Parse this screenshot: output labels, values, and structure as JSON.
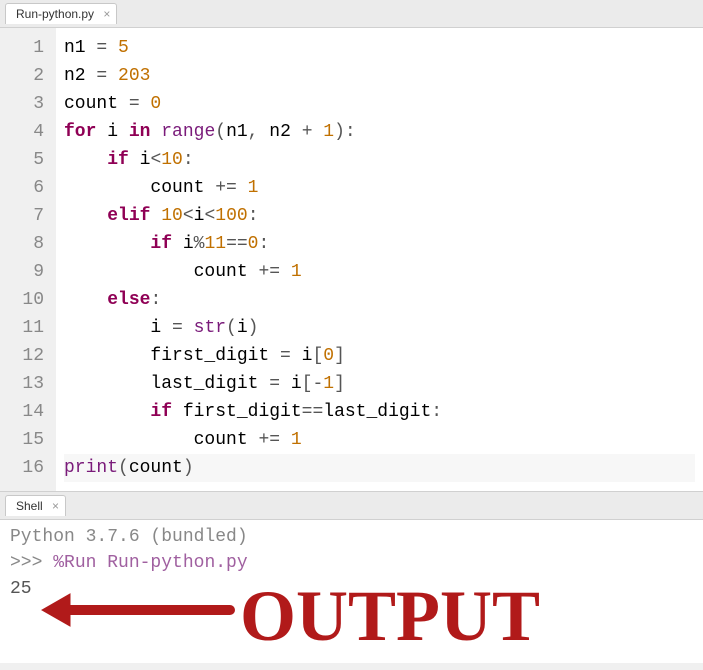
{
  "editor_tab": {
    "title": "Run-python.py"
  },
  "gutter": [
    "1",
    "2",
    "3",
    "4",
    "5",
    "6",
    "7",
    "8",
    "9",
    "10",
    "11",
    "12",
    "13",
    "14",
    "15",
    "16"
  ],
  "code": {
    "l1": [
      [
        "name",
        "n1"
      ],
      [
        "op",
        " = "
      ],
      [
        "num",
        "5"
      ]
    ],
    "l2": [
      [
        "name",
        "n2"
      ],
      [
        "op",
        " = "
      ],
      [
        "num",
        "203"
      ]
    ],
    "l3": [
      [
        "name",
        "count"
      ],
      [
        "op",
        " = "
      ],
      [
        "num",
        "0"
      ]
    ],
    "l4": [
      [
        "kw",
        "for"
      ],
      [
        "name",
        " i "
      ],
      [
        "kw",
        "in"
      ],
      [
        "name",
        " "
      ],
      [
        "builtin",
        "range"
      ],
      [
        "paren",
        "("
      ],
      [
        "name",
        "n1"
      ],
      [
        "punc",
        ", "
      ],
      [
        "name",
        "n2"
      ],
      [
        "op",
        " + "
      ],
      [
        "num",
        "1"
      ],
      [
        "paren",
        ")"
      ],
      [
        "punc",
        ":"
      ]
    ],
    "l5": [
      [
        "name",
        "    "
      ],
      [
        "kw",
        "if"
      ],
      [
        "name",
        " i"
      ],
      [
        "op",
        "<"
      ],
      [
        "num",
        "10"
      ],
      [
        "punc",
        ":"
      ]
    ],
    "l6": [
      [
        "name",
        "        count "
      ],
      [
        "op",
        "+= "
      ],
      [
        "num",
        "1"
      ]
    ],
    "l7": [
      [
        "name",
        "    "
      ],
      [
        "kw",
        "elif"
      ],
      [
        "name",
        " "
      ],
      [
        "num",
        "10"
      ],
      [
        "op",
        "<"
      ],
      [
        "name",
        "i"
      ],
      [
        "op",
        "<"
      ],
      [
        "num",
        "100"
      ],
      [
        "punc",
        ":"
      ]
    ],
    "l8": [
      [
        "name",
        "        "
      ],
      [
        "kw",
        "if"
      ],
      [
        "name",
        " i"
      ],
      [
        "op",
        "%"
      ],
      [
        "num",
        "11"
      ],
      [
        "op",
        "=="
      ],
      [
        "num",
        "0"
      ],
      [
        "punc",
        ":"
      ]
    ],
    "l9": [
      [
        "name",
        "            count "
      ],
      [
        "op",
        "+= "
      ],
      [
        "num",
        "1"
      ]
    ],
    "l10": [
      [
        "name",
        "    "
      ],
      [
        "kw",
        "else"
      ],
      [
        "punc",
        ":"
      ]
    ],
    "l11": [
      [
        "name",
        "        i "
      ],
      [
        "op",
        "= "
      ],
      [
        "builtin",
        "str"
      ],
      [
        "paren",
        "("
      ],
      [
        "name",
        "i"
      ],
      [
        "paren",
        ")"
      ]
    ],
    "l12": [
      [
        "name",
        "        first_digit "
      ],
      [
        "op",
        "= "
      ],
      [
        "name",
        "i"
      ],
      [
        "paren",
        "["
      ],
      [
        "num",
        "0"
      ],
      [
        "paren",
        "]"
      ]
    ],
    "l13": [
      [
        "name",
        "        last_digit "
      ],
      [
        "op",
        "= "
      ],
      [
        "name",
        "i"
      ],
      [
        "paren",
        "["
      ],
      [
        "op",
        "-"
      ],
      [
        "num",
        "1"
      ],
      [
        "paren",
        "]"
      ]
    ],
    "l14": [
      [
        "name",
        "        "
      ],
      [
        "kw",
        "if"
      ],
      [
        "name",
        " first_digit"
      ],
      [
        "op",
        "=="
      ],
      [
        "name",
        "last_digit"
      ],
      [
        "punc",
        ":"
      ]
    ],
    "l15": [
      [
        "name",
        "            count "
      ],
      [
        "op",
        "+= "
      ],
      [
        "num",
        "1"
      ]
    ],
    "l16": [
      [
        "builtin",
        "print"
      ],
      [
        "paren",
        "("
      ],
      [
        "name",
        "count"
      ],
      [
        "paren",
        ")"
      ]
    ]
  },
  "shell_tab": {
    "title": "Shell"
  },
  "shell": {
    "version": "Python 3.7.6 (bundled)",
    "prompt": ">>> ",
    "run_cmd": "%Run Run-python.py",
    "output": " 25"
  },
  "annotation": {
    "text": "OUTPUT",
    "color": "#b11a1a"
  }
}
